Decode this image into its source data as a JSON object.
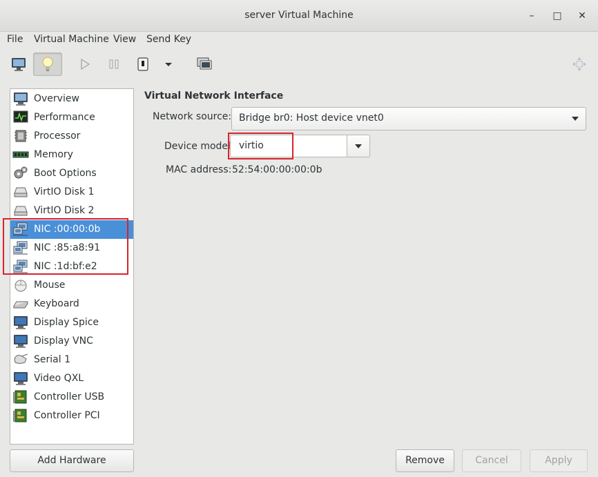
{
  "window": {
    "title": "server Virtual Machine",
    "minimize_glyph": "–",
    "maximize_glyph": "□",
    "close_glyph": "✕"
  },
  "menu": [
    "File",
    "Virtual Machine",
    "View",
    "Send Key"
  ],
  "toolbar": {
    "buttons": [
      "monitor-icon",
      "lightbulb-icon",
      "run-icon",
      "pause-icon",
      "shutdown-icon",
      "shutdown-menu-icon",
      "snapshots-icon",
      "fullscreen-icon"
    ],
    "active": "lightbulb-icon"
  },
  "sidebar": {
    "items": [
      {
        "label": "Overview",
        "icon": "monitor-icon"
      },
      {
        "label": "Performance",
        "icon": "performance-icon"
      },
      {
        "label": "Processor",
        "icon": "processor-icon"
      },
      {
        "label": "Memory",
        "icon": "memory-icon"
      },
      {
        "label": "Boot Options",
        "icon": "gears-icon"
      },
      {
        "label": "VirtIO Disk 1",
        "icon": "disk-icon"
      },
      {
        "label": "VirtIO Disk 2",
        "icon": "disk-icon"
      },
      {
        "label": "NIC :00:00:0b",
        "icon": "network-icon"
      },
      {
        "label": "NIC :85:a8:91",
        "icon": "network-icon"
      },
      {
        "label": "NIC :1d:bf:e2",
        "icon": "network-icon"
      },
      {
        "label": "Mouse",
        "icon": "mouse-icon"
      },
      {
        "label": "Keyboard",
        "icon": "keyboard-icon"
      },
      {
        "label": "Display Spice",
        "icon": "monitor-icon"
      },
      {
        "label": "Display VNC",
        "icon": "monitor-icon"
      },
      {
        "label": "Serial 1",
        "icon": "serial-icon"
      },
      {
        "label": "Video QXL",
        "icon": "monitor-icon"
      },
      {
        "label": "Controller USB",
        "icon": "controller-icon"
      },
      {
        "label": "Controller PCI",
        "icon": "controller-icon"
      }
    ],
    "selected_index": 7
  },
  "details": {
    "title": "Virtual Network Interface",
    "network_source_label": "Network source:",
    "network_source_value": "Bridge br0: Host device vnet0",
    "device_model_label": "Device model:",
    "device_model_value": "virtio",
    "mac_label": "MAC address:",
    "mac_value": "52:54:00:00:00:0b"
  },
  "buttons": {
    "add_hardware": "Add Hardware",
    "remove": "Remove",
    "cancel": "Cancel",
    "apply": "Apply"
  },
  "colors": {
    "selection": "#4a90d9",
    "highlight_box": "#d9222a"
  }
}
